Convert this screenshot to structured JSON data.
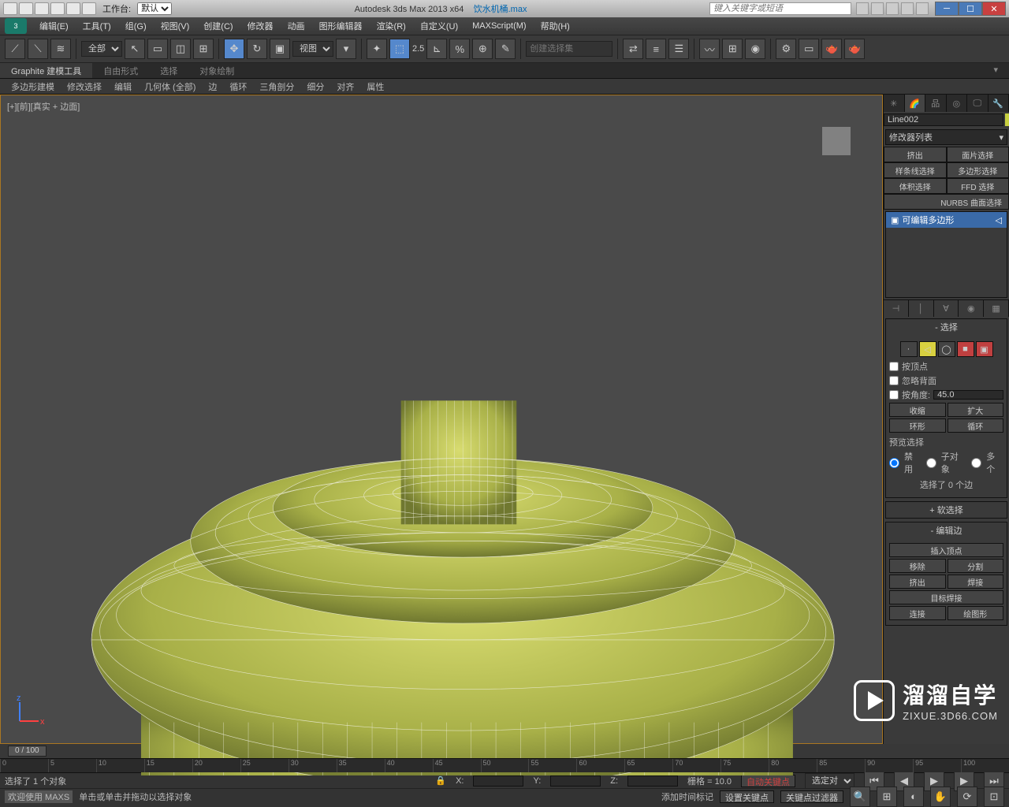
{
  "titlebar": {
    "workspace_label": "工作台:",
    "workspace_value": "默认",
    "app": "Autodesk 3ds Max  2013 x64",
    "filename": "饮水机桶.max",
    "search_placeholder": "键入关键字或短语"
  },
  "menu": [
    "编辑(E)",
    "工具(T)",
    "组(G)",
    "视图(V)",
    "创建(C)",
    "修改器",
    "动画",
    "图形编辑器",
    "渲染(R)",
    "自定义(U)",
    "MAXScript(M)",
    "帮助(H)"
  ],
  "toolbar": {
    "selection_filter": "全部",
    "ref_coord": "视图",
    "named_sel_placeholder": "创建选择集",
    "snap_angle": "2.5"
  },
  "graphite": {
    "tabs": [
      "Graphite 建模工具",
      "自由形式",
      "选择",
      "对象绘制"
    ],
    "ribbon": [
      "多边形建模",
      "修改选择",
      "编辑",
      "几何体 (全部)",
      "边",
      "循环",
      "三角剖分",
      "细分",
      "对齐",
      "属性"
    ]
  },
  "viewport": {
    "label": "[+][前][真实 + 边面]"
  },
  "cmdpanel": {
    "obj_name": "Line002",
    "modlist_label": "修改器列表",
    "mod_buttons": [
      "挤出",
      "面片选择",
      "样条线选择",
      "多边形选择",
      "体积选择",
      "FFD 选择"
    ],
    "mod_buttons_full": "NURBS 曲面选择",
    "stack_item": "可编辑多边形",
    "rollouts": {
      "selection": {
        "title": "选择",
        "by_vertex": "按顶点",
        "ignore_back": "忽略背面",
        "by_angle": "按角度:",
        "angle": "45.0",
        "shrink": "收缩",
        "grow": "扩大",
        "ring": "环形",
        "loop": "循环",
        "preview": "预览选择",
        "disable": "禁用",
        "subobj": "子对象",
        "multi": "多个",
        "info": "选择了 0 个边"
      },
      "soft_sel": {
        "title": "软选择"
      },
      "edit_edge": {
        "title": "编辑边",
        "insert_vtx": "插入顶点",
        "remove": "移除",
        "split": "分割",
        "extrude": "挤出",
        "weld": "焊接",
        "target_weld": "目标焊接",
        "connect": "连接",
        "draw_shape": "绘图形"
      }
    }
  },
  "timeline": {
    "slider": "0 / 100",
    "ticks": [
      "0",
      "5",
      "10",
      "15",
      "20",
      "25",
      "30",
      "35",
      "40",
      "45",
      "50",
      "55",
      "60",
      "65",
      "70",
      "75",
      "80",
      "85",
      "90",
      "95",
      "100"
    ]
  },
  "status": {
    "sel_info": "选择了 1 个对象",
    "x_label": "X:",
    "y_label": "Y:",
    "z_label": "Z:",
    "grid": "栅格 = 10.0",
    "autokey": "自动关键点",
    "sel_lock": "选定对",
    "welcome": "欢迎使用  MAXS",
    "hint": "单击或单击并拖动以选择对象",
    "add_time": "添加时间标记",
    "set_key": "设置关键点",
    "key_filter": "关键点过滤器"
  },
  "watermark": {
    "line1": "溜溜自学",
    "line2": "ZIXUE.3D66.COM"
  }
}
